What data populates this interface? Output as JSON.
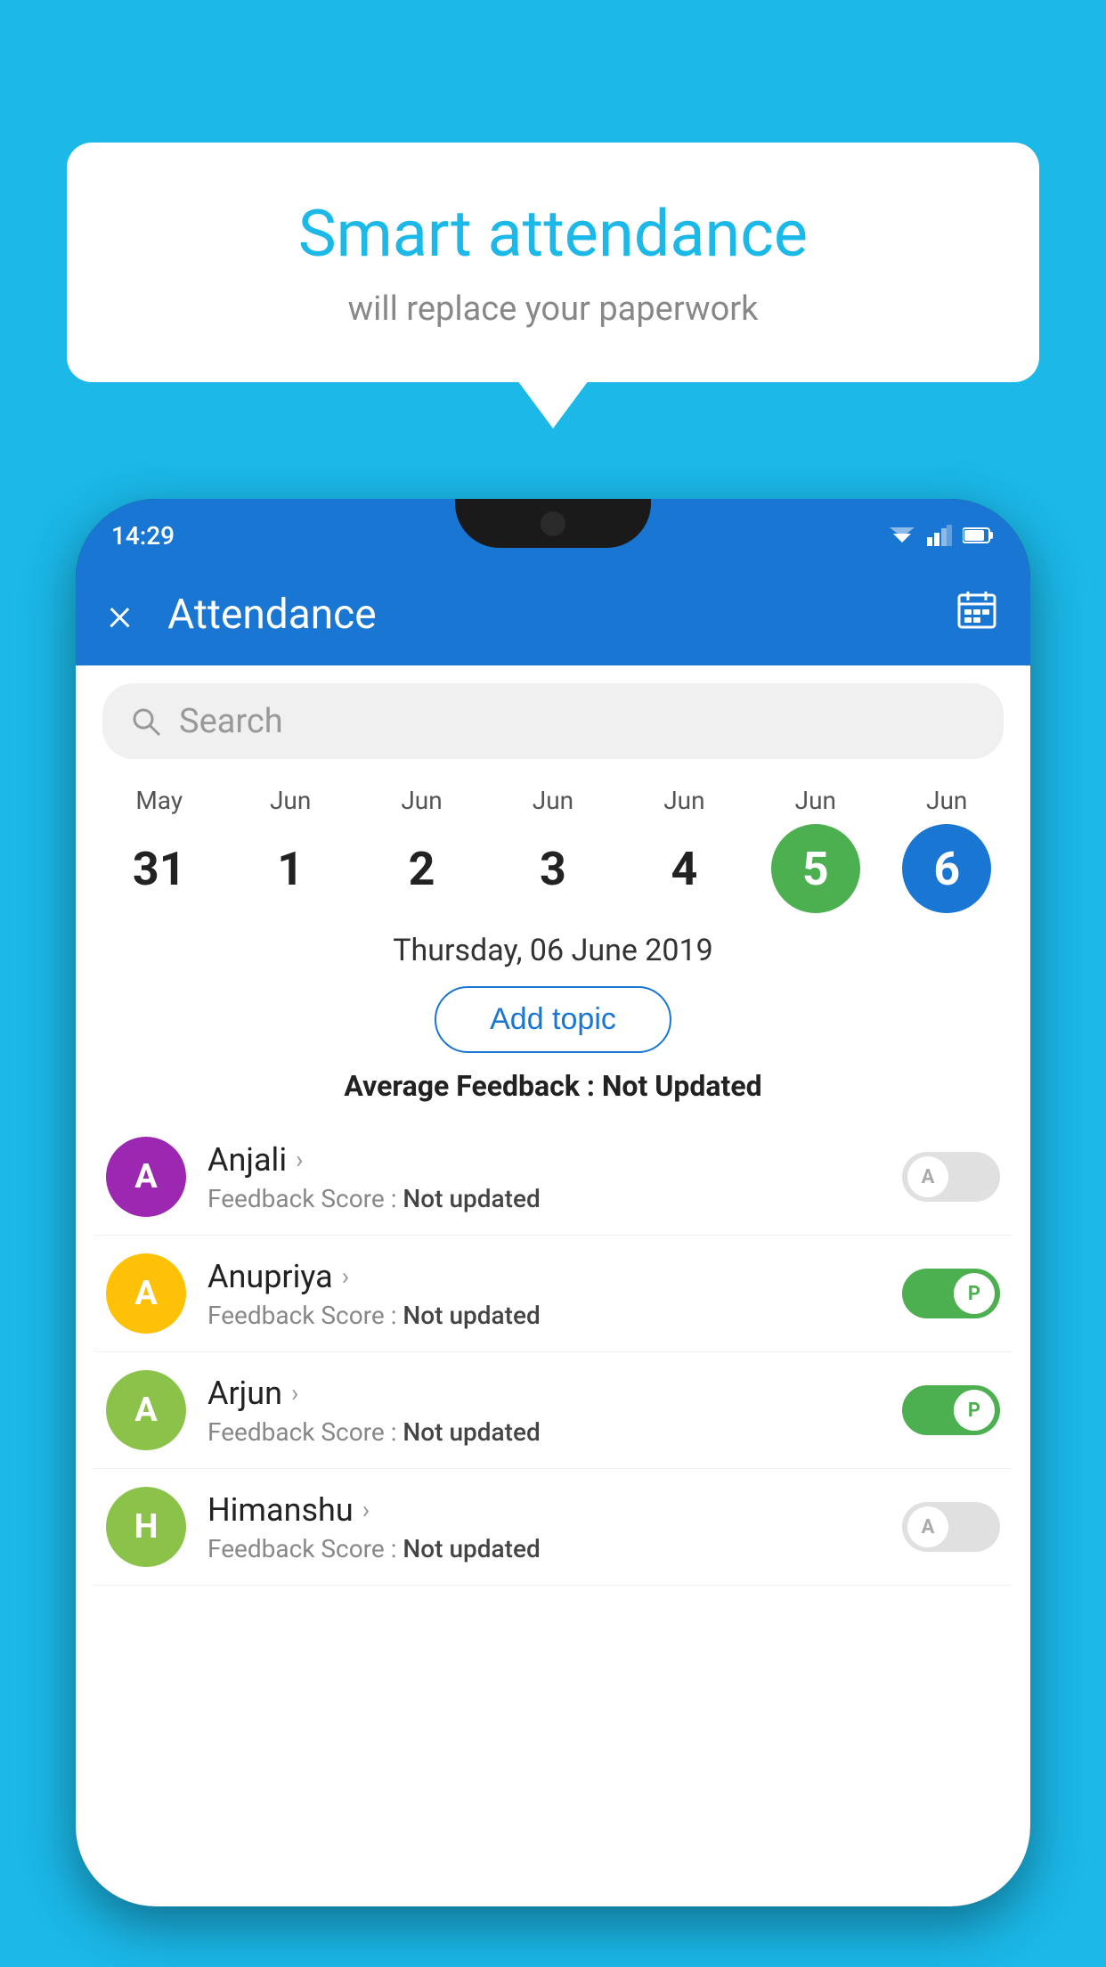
{
  "background_color": "#1BB8E8",
  "bubble": {
    "title": "Smart attendance",
    "subtitle": "will replace your paperwork"
  },
  "app": {
    "screen_title": "Attendance",
    "close_label": "×",
    "status_time": "14:29"
  },
  "search": {
    "placeholder": "Search"
  },
  "calendar": {
    "days": [
      {
        "month": "May",
        "num": "31",
        "state": "normal"
      },
      {
        "month": "Jun",
        "num": "1",
        "state": "normal"
      },
      {
        "month": "Jun",
        "num": "2",
        "state": "normal"
      },
      {
        "month": "Jun",
        "num": "3",
        "state": "normal"
      },
      {
        "month": "Jun",
        "num": "4",
        "state": "normal"
      },
      {
        "month": "Jun",
        "num": "5",
        "state": "today"
      },
      {
        "month": "Jun",
        "num": "6",
        "state": "selected"
      }
    ]
  },
  "selected_date": "Thursday, 06 June 2019",
  "add_topic_label": "Add topic",
  "average_feedback": {
    "label": "Average Feedback : ",
    "value": "Not Updated"
  },
  "students": [
    {
      "name": "Anjali",
      "initial": "A",
      "avatar_color": "#9C27B0",
      "feedback": "Not updated",
      "attendance": "absent"
    },
    {
      "name": "Anupriya",
      "initial": "A",
      "avatar_color": "#FFC107",
      "feedback": "Not updated",
      "attendance": "present"
    },
    {
      "name": "Arjun",
      "initial": "A",
      "avatar_color": "#8BC34A",
      "feedback": "Not updated",
      "attendance": "present"
    },
    {
      "name": "Himanshu",
      "initial": "H",
      "avatar_color": "#8BC34A",
      "feedback": "Not updated",
      "attendance": "absent"
    }
  ],
  "feedback_label": "Feedback Score : ",
  "toggle_present_label": "P",
  "toggle_absent_label": "A"
}
